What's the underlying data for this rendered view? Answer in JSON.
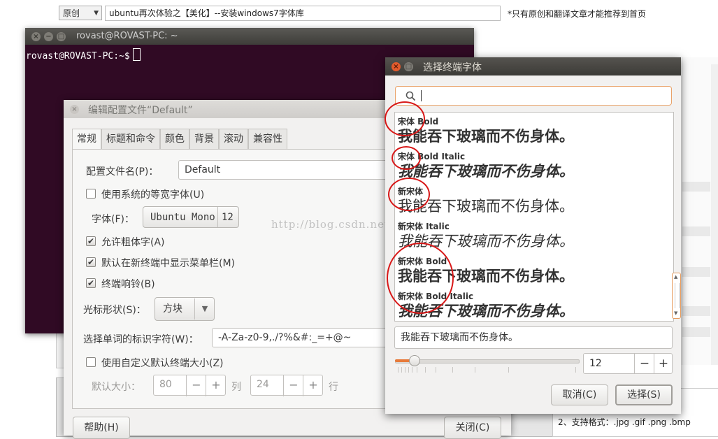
{
  "web_page": {
    "category_select": "原创",
    "article_title": "ubuntu再次体验之【美化】--安装windows7字体库",
    "note": "*只有原创和翻译文章才能推荐到首页",
    "upload_hint": "2、支持格式：.jpg .gif .png .bmp"
  },
  "terminal": {
    "title": "rovast@ROVAST-PC: ~",
    "prompt": "rovast@ROVAST-PC:~$"
  },
  "profile_dialog": {
    "title": "编辑配置文件“Default”",
    "tabs": [
      "常规",
      "标题和命令",
      "颜色",
      "背景",
      "滚动",
      "兼容性"
    ],
    "profile_name_label": "配置文件名(P)：",
    "profile_name_value": "Default",
    "use_system_font_label": "使用系统的等宽字体(U)",
    "font_label": "字体(F)：",
    "font_name": "Ubuntu Mono",
    "font_size": "12",
    "allow_bold_label": "允许粗体字(A)",
    "show_menubar_label": "默认在新终端中显示菜单栏(M)",
    "terminal_bell_label": "终端响铃(B)",
    "cursor_shape_label": "光标形状(S)：",
    "cursor_shape_value": "方块",
    "word_chars_label": "选择单词的标识字符(W)：",
    "word_chars_value": "-A-Za-z0-9,./?%&#:_=+@~",
    "custom_size_label": "使用自定义默认终端大小(Z)",
    "default_size_label": "默认大小：",
    "cols_value": "80",
    "cols_unit": "列",
    "rows_value": "24",
    "rows_unit": "行",
    "help_button": "帮助(H)",
    "close_button": "关闭(C)"
  },
  "font_chooser": {
    "title": "选择终端字体",
    "search_placeholder": "",
    "fonts": [
      {
        "family": "宋体 Bold",
        "sample": "我能吞下玻璃而不伤身体。",
        "style": "bold"
      },
      {
        "family": "宋体 Bold Italic",
        "sample": "我能吞下玻璃而不伤身体。",
        "style": "bold-italic"
      },
      {
        "family": "新宋体",
        "sample": "我能吞下玻璃而不伤身体。",
        "style": "regular"
      },
      {
        "family": "新宋体 Italic",
        "sample": "我能吞下玻璃而不伤身体。",
        "style": "italic"
      },
      {
        "family": "新宋体 Bold",
        "sample": "我能吞下玻璃而不伤身体。",
        "style": "bold"
      },
      {
        "family": "新宋体 Bold Italic",
        "sample": "我能吞下玻璃而不伤身体。",
        "style": "bold-italic"
      }
    ],
    "preview_text": "我能吞下玻璃而不伤身体。",
    "size_value": "12",
    "minus": "−",
    "plus": "+",
    "cancel_button": "取消(C)",
    "select_button": "选择(S)"
  },
  "watermark": "http://blog.csdn.net/ROVAST",
  "colors": {
    "terminal_bg": "#300a24",
    "accent_orange": "#e77a3a",
    "annotation_red": "#d81818",
    "titlebar_dark": "#3c3b37"
  },
  "icons": {
    "close": "×",
    "minimize": "−",
    "maximize": "□",
    "search": "search-icon",
    "dropdown": "▼",
    "check": "✔"
  }
}
